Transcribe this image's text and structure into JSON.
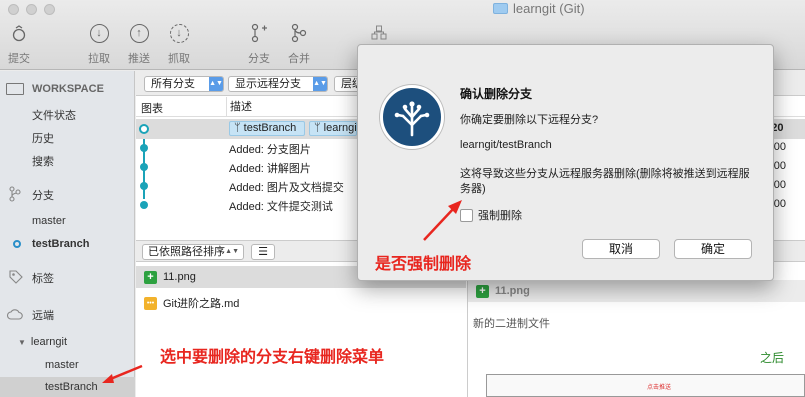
{
  "window": {
    "title": "learngit (Git)"
  },
  "toolbar": {
    "items": [
      {
        "label": "提交",
        "icon": "commit-icon"
      },
      {
        "label": "拉取",
        "icon": "pull-icon"
      },
      {
        "label": "推送",
        "icon": "push-icon"
      },
      {
        "label": "抓取",
        "icon": "fetch-icon"
      },
      {
        "label": "分支",
        "icon": "branch-icon"
      },
      {
        "label": "合并",
        "icon": "merge-icon"
      }
    ]
  },
  "sidebar": {
    "workspace": "WORKSPACE",
    "workspace_items": [
      "文件状态",
      "历史",
      "搜索"
    ],
    "branches_header": "分支",
    "branches": [
      "master",
      "testBranch"
    ],
    "tags_header": "标签",
    "remotes_header": "远端",
    "remote_name": "learngit",
    "remote_branches": [
      "master",
      "testBranch"
    ]
  },
  "filters": {
    "branches": "所有分支",
    "remote": "显示远程分支",
    "order": "层级"
  },
  "columns": {
    "graph": "图表",
    "description": "描述"
  },
  "commits": [
    {
      "tags": [
        "testBranch",
        "learngit"
      ],
      "subject": "",
      "author": "wu20"
    },
    {
      "tags": [],
      "subject": "Added: 分支图片",
      "author": "vu200"
    },
    {
      "tags": [],
      "subject": "Added: 讲解图片",
      "author": "vu200"
    },
    {
      "tags": [],
      "subject": "Added: 图片及文档提交",
      "author": "vu200"
    },
    {
      "tags": [],
      "subject": "Added: 文件提交测试",
      "author": "vu200"
    }
  ],
  "files": {
    "sort_label": "已依照路径排序",
    "menu_label": "☰",
    "items": [
      {
        "name": "11.png",
        "status": "added"
      },
      {
        "name": "Git进阶之路.md",
        "status": "modified"
      }
    ]
  },
  "preview": {
    "filename": "11.png",
    "label": "新的二进制文件",
    "after_label": "之后",
    "thumb_note": "点击推送"
  },
  "dialog": {
    "title": "确认删除分支",
    "question": "你确定要删除以下远程分支?",
    "branch": "learngit/testBranch",
    "warning": "这将导致这些分支从远程服务器删除(删除将被推送到远程服务器)",
    "checkbox_label": "强制删除",
    "cancel_label": "取消",
    "ok_label": "确定"
  },
  "annotations": {
    "force_delete": "是否强制删除",
    "instruction": "选中要删除的分支右键删除菜单"
  },
  "colors": {
    "accent": "#1aa3b8",
    "annotation": "#e8261f",
    "logo": "#1d4f7d"
  }
}
